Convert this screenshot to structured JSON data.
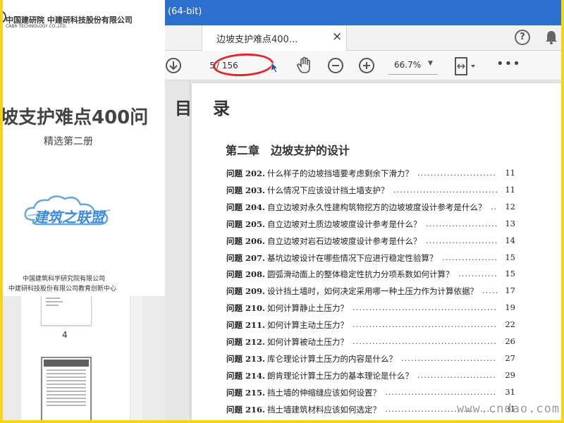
{
  "window": {
    "title": "(64-bit)"
  },
  "tabbar": {
    "tab_label": "边坡支护难点400...",
    "close_glyph": "×",
    "help_glyph": "?",
    "icons": [
      "help-icon",
      "bell-icon"
    ]
  },
  "toolbar": {
    "page_current": "5",
    "page_total": "/ 156",
    "zoom": "66.7%",
    "more_glyph": "•••",
    "icons": [
      "download-icon",
      "hand-tool-icon",
      "zoom-out-icon",
      "zoom-in-icon",
      "fit-page-icon",
      "more-icon"
    ]
  },
  "cover": {
    "logo_cn": "中国建研院 中建研科技股份有限公司",
    "logo_en": "CABR TECHNOLOGY CO.,LTD.",
    "title": "坡支护难点400问",
    "subtitle": "精选第二册",
    "brand": "建筑之联盟",
    "org_line1": "中国建筑科学研究院有限公司",
    "org_line2": "中建研科技股份有限公司教育创新中心"
  },
  "thumbnails": {
    "page_label": "4"
  },
  "document": {
    "toc_title": "目录",
    "chapter": "第二章　边坡支护的设计",
    "entries": [
      {
        "num": "问题 202.",
        "q": "什么样子的边坡挡墙要考虑剩余下滑力？",
        "page": "11"
      },
      {
        "num": "问题 203.",
        "q": "什么情况下应该设计挡土墙支护？",
        "page": "11"
      },
      {
        "num": "问题 204.",
        "q": "自立边坡对永久性建构筑物挖方的边坡坡度设计参考是什么？",
        "page": "12"
      },
      {
        "num": "问题 205.",
        "q": "自立边坡对土质边坡坡度设计参考是什么？",
        "page": "13"
      },
      {
        "num": "问题 206.",
        "q": "自立边坡对岩石边坡坡度设计参考是什么？",
        "page": "14"
      },
      {
        "num": "问题 207.",
        "q": "基坑边坡设计在哪些情况下应进行稳定性验算？",
        "page": "15"
      },
      {
        "num": "问题 208.",
        "q": "圆弧滑动面上的整体稳定性抗力分项系数如何计算？",
        "page": "15"
      },
      {
        "num": "问题 209.",
        "q": "设计挡土墙时，如何决定采用哪一种土压力作为计算依据？",
        "page": "17"
      },
      {
        "num": "问题 210.",
        "q": "如何计算静止土压力？",
        "page": "19"
      },
      {
        "num": "问题 211.",
        "q": "如何计算主动土压力？",
        "page": "22"
      },
      {
        "num": "问题 212.",
        "q": "如何计算被动土压力？",
        "page": "26"
      },
      {
        "num": "问题 213.",
        "q": "库仑理论计算土压力的内容是什么？",
        "page": "27"
      },
      {
        "num": "问题 214.",
        "q": "朗肯理论计算土压力的基本理论是什么？",
        "page": "29"
      },
      {
        "num": "问题 215.",
        "q": "挡土墙的伸缩缝应该如何设置？",
        "page": "31"
      },
      {
        "num": "问题 216.",
        "q": "挡土墙建筑材料应该如何选定？",
        "page": "31"
      }
    ]
  },
  "watermark": "www.cndao.com",
  "colors": {
    "titlebar": "#2c6fcc",
    "frame": "#f5d51c",
    "annotation": "#e3262c"
  }
}
